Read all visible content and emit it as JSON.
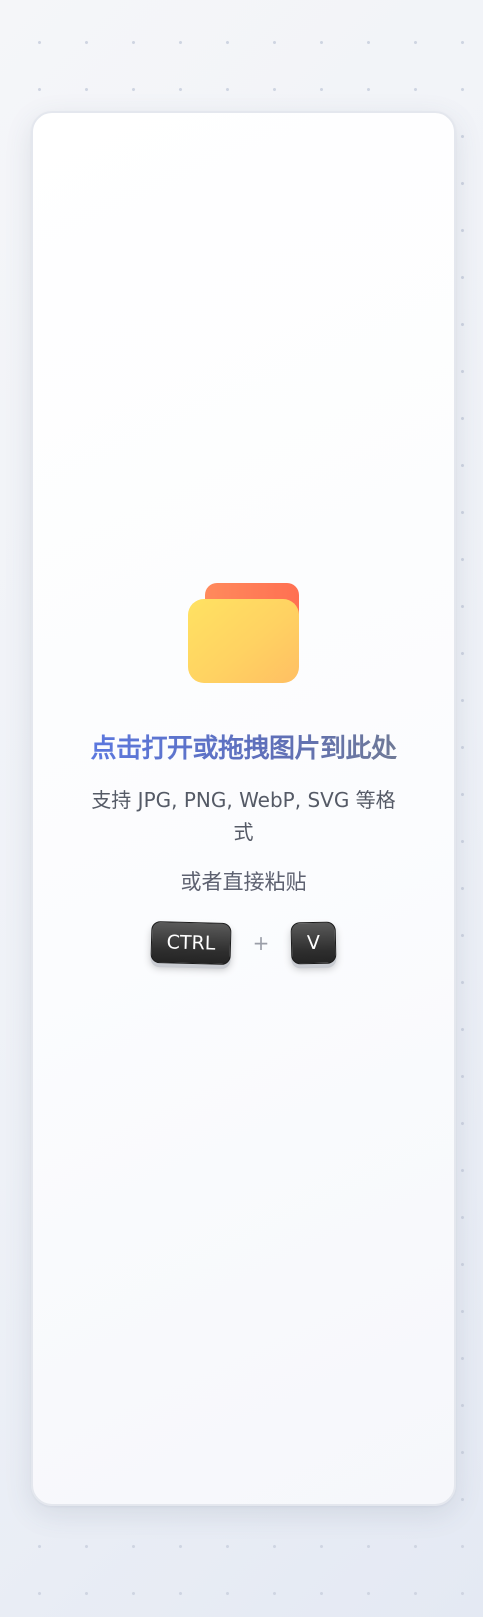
{
  "drop_zone": {
    "icon": "folder-icon",
    "title": "点击打开或拖拽图片到此处",
    "formats_text": "支持 JPG, PNG, WebP, SVG 等格式",
    "paste_text": "或者直接粘贴",
    "shortcut": {
      "key1": "CTRL",
      "separator": "+",
      "key2": "V"
    }
  },
  "colors": {
    "title_gradient_start": "#5b78e0",
    "title_gradient_end": "#707a95",
    "folder_tab": "#ff7a57",
    "folder_body": "#ffd262",
    "key_background": "#2e2e2e"
  }
}
